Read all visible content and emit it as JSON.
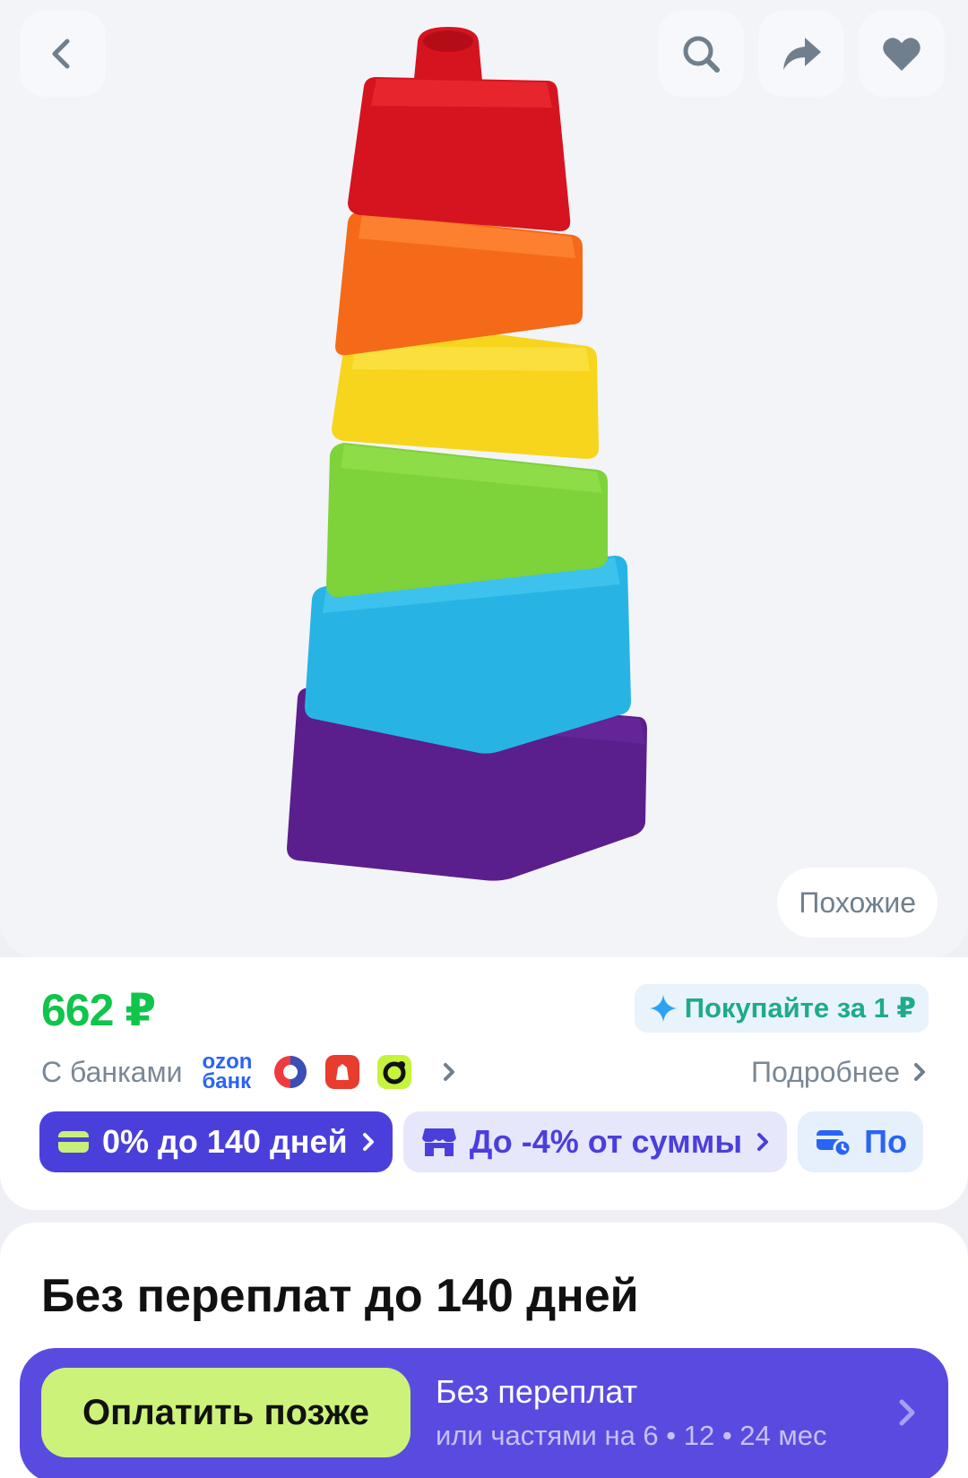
{
  "gallery": {
    "similar_label": "Похожие"
  },
  "product": {
    "price": "662 ₽",
    "promo": "Покупайте за 1 ₽",
    "banks_label": "С банками",
    "ozon_bank_line1": "ozon",
    "ozon_bank_line2": "банк",
    "more_label": "Подробнее",
    "chips": [
      {
        "label": "0% до 140 дней"
      },
      {
        "label": "До -4% от суммы"
      },
      {
        "label": "По"
      }
    ]
  },
  "installment": {
    "title": "Без переплат до 140 дней",
    "button_label": "Оплатить позже",
    "line1": "Без переплат",
    "line2": "или частями на 6 • 12 • 24 мес"
  },
  "colors": {
    "price_green": "#10c44c",
    "accent_violet": "#4b3fdc",
    "pay_later_lime": "#ccf27a"
  },
  "icons": [
    "back-icon",
    "search-icon",
    "share-icon",
    "heart-icon",
    "sparkle-icon",
    "card-icon",
    "store-icon",
    "card-clock-icon"
  ]
}
